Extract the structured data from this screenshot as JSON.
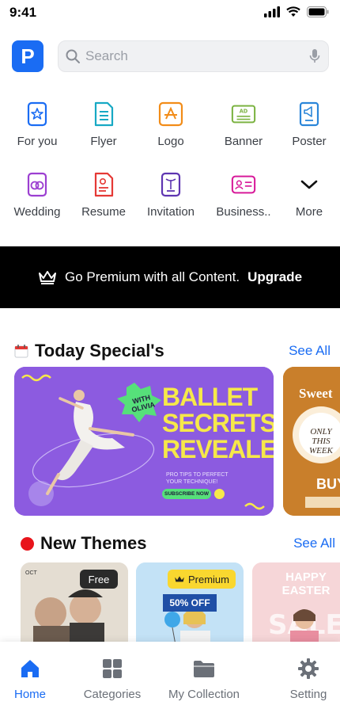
{
  "status": {
    "time": "9:41"
  },
  "app": {
    "logo_letter": "P"
  },
  "search": {
    "placeholder": "Search",
    "value": ""
  },
  "categories": [
    {
      "label": "For you",
      "icon": "star-badge-icon",
      "color": "#1a6cf3"
    },
    {
      "label": "Flyer",
      "icon": "flyer-icon",
      "color": "#17a9c4"
    },
    {
      "label": "Logo",
      "icon": "logo-design-icon",
      "color": "#f28c18"
    },
    {
      "label": "Banner",
      "icon": "banner-ad-icon",
      "color": "#7cb342"
    },
    {
      "label": "Poster",
      "icon": "poster-megaphone-icon",
      "color": "#2b86d9"
    },
    {
      "label": "Wedding",
      "icon": "wedding-rings-icon",
      "color": "#9c3fd1"
    },
    {
      "label": "Resume",
      "icon": "resume-icon",
      "color": "#e53935"
    },
    {
      "label": "Invitation",
      "icon": "invitation-icon",
      "color": "#5e35b1"
    },
    {
      "label": "Business..",
      "icon": "business-card-icon",
      "color": "#d81b9a"
    },
    {
      "label": "More",
      "icon": "chevron-down-icon",
      "color": "#111111"
    }
  ],
  "premium": {
    "text": "Go Premium with all Content.",
    "cta": "Upgrade"
  },
  "today_special": {
    "title": "Today Special's",
    "see_all": "See All",
    "card1": {
      "badge_line1": "WITH",
      "badge_line2": "OLIVIA",
      "headline_1": "BALLET",
      "headline_2": "SECRETS",
      "headline_3": "REVEALED",
      "sub_1": "PRO TIPS TO PERFECT",
      "sub_2": "YOUR TECHNIQUE!",
      "button": "SUBSCRIBE NOW"
    },
    "card2": {
      "title": "Sweet",
      "badge_1": "ONLY",
      "badge_2": "THIS",
      "badge_3": "WEEK",
      "cta": "BUY"
    }
  },
  "new_themes": {
    "title": "New Themes",
    "see_all": "See All",
    "cards": [
      {
        "tag": "Free",
        "corner": "OCT"
      },
      {
        "tag": "Premium",
        "price": "50% OFF"
      },
      {
        "line1": "HAPPY",
        "line2": "EASTER"
      }
    ]
  },
  "tabs": [
    {
      "label": "Home",
      "icon": "home-icon",
      "active": true
    },
    {
      "label": "Categories",
      "icon": "categories-grid-icon",
      "active": false
    },
    {
      "label": "My Collection",
      "icon": "folder-icon",
      "active": false
    },
    {
      "label": "Setting",
      "icon": "gear-icon",
      "active": false
    }
  ],
  "colors": {
    "accent": "#1a6cf3",
    "premium_bar": "#000000",
    "new_dot": "#e8141b"
  }
}
